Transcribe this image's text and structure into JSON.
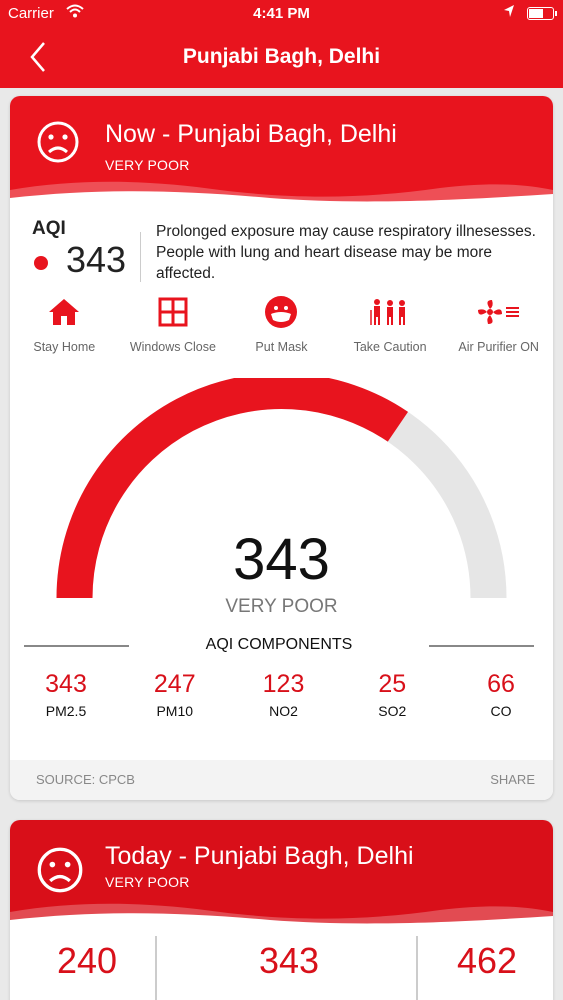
{
  "status_bar": {
    "carrier": "Carrier",
    "time": "4:41 PM"
  },
  "nav": {
    "title": "Punjabi Bagh, Delhi"
  },
  "now_card": {
    "title": "Now - Punjabi Bagh, Delhi",
    "category": "VERY POOR",
    "aqi_label": "AQI",
    "aqi_value": "343",
    "description": "Prolonged exposure may cause respiratory illnesesses. People with lung and heart disease may be more affected.",
    "advice": [
      {
        "label": "Stay Home",
        "icon": "home-icon"
      },
      {
        "label": "Windows Close",
        "icon": "window-icon"
      },
      {
        "label": "Put Mask",
        "icon": "mask-icon"
      },
      {
        "label": "Take Caution",
        "icon": "people-caution-icon"
      },
      {
        "label": "Air Purifier ON",
        "icon": "air-purifier-icon"
      }
    ],
    "gauge": {
      "value": "343",
      "category": "VERY POOR",
      "fill_fraction": 0.69
    },
    "components_title": "AQI COMPONENTS",
    "components": [
      {
        "value": "343",
        "name": "PM2.5"
      },
      {
        "value": "247",
        "name": "PM10"
      },
      {
        "value": "123",
        "name": "NO2"
      },
      {
        "value": "25",
        "name": "SO2"
      },
      {
        "value": "66",
        "name": "CO"
      }
    ],
    "source": "SOURCE: CPCB",
    "share": "SHARE"
  },
  "today_card": {
    "title": "Today - Punjabi Bagh, Delhi",
    "category": "VERY POOR",
    "values": [
      "240",
      "343",
      "462"
    ]
  },
  "colors": {
    "brand_red": "#e8141e",
    "gauge_track": "#e6e6e6"
  }
}
